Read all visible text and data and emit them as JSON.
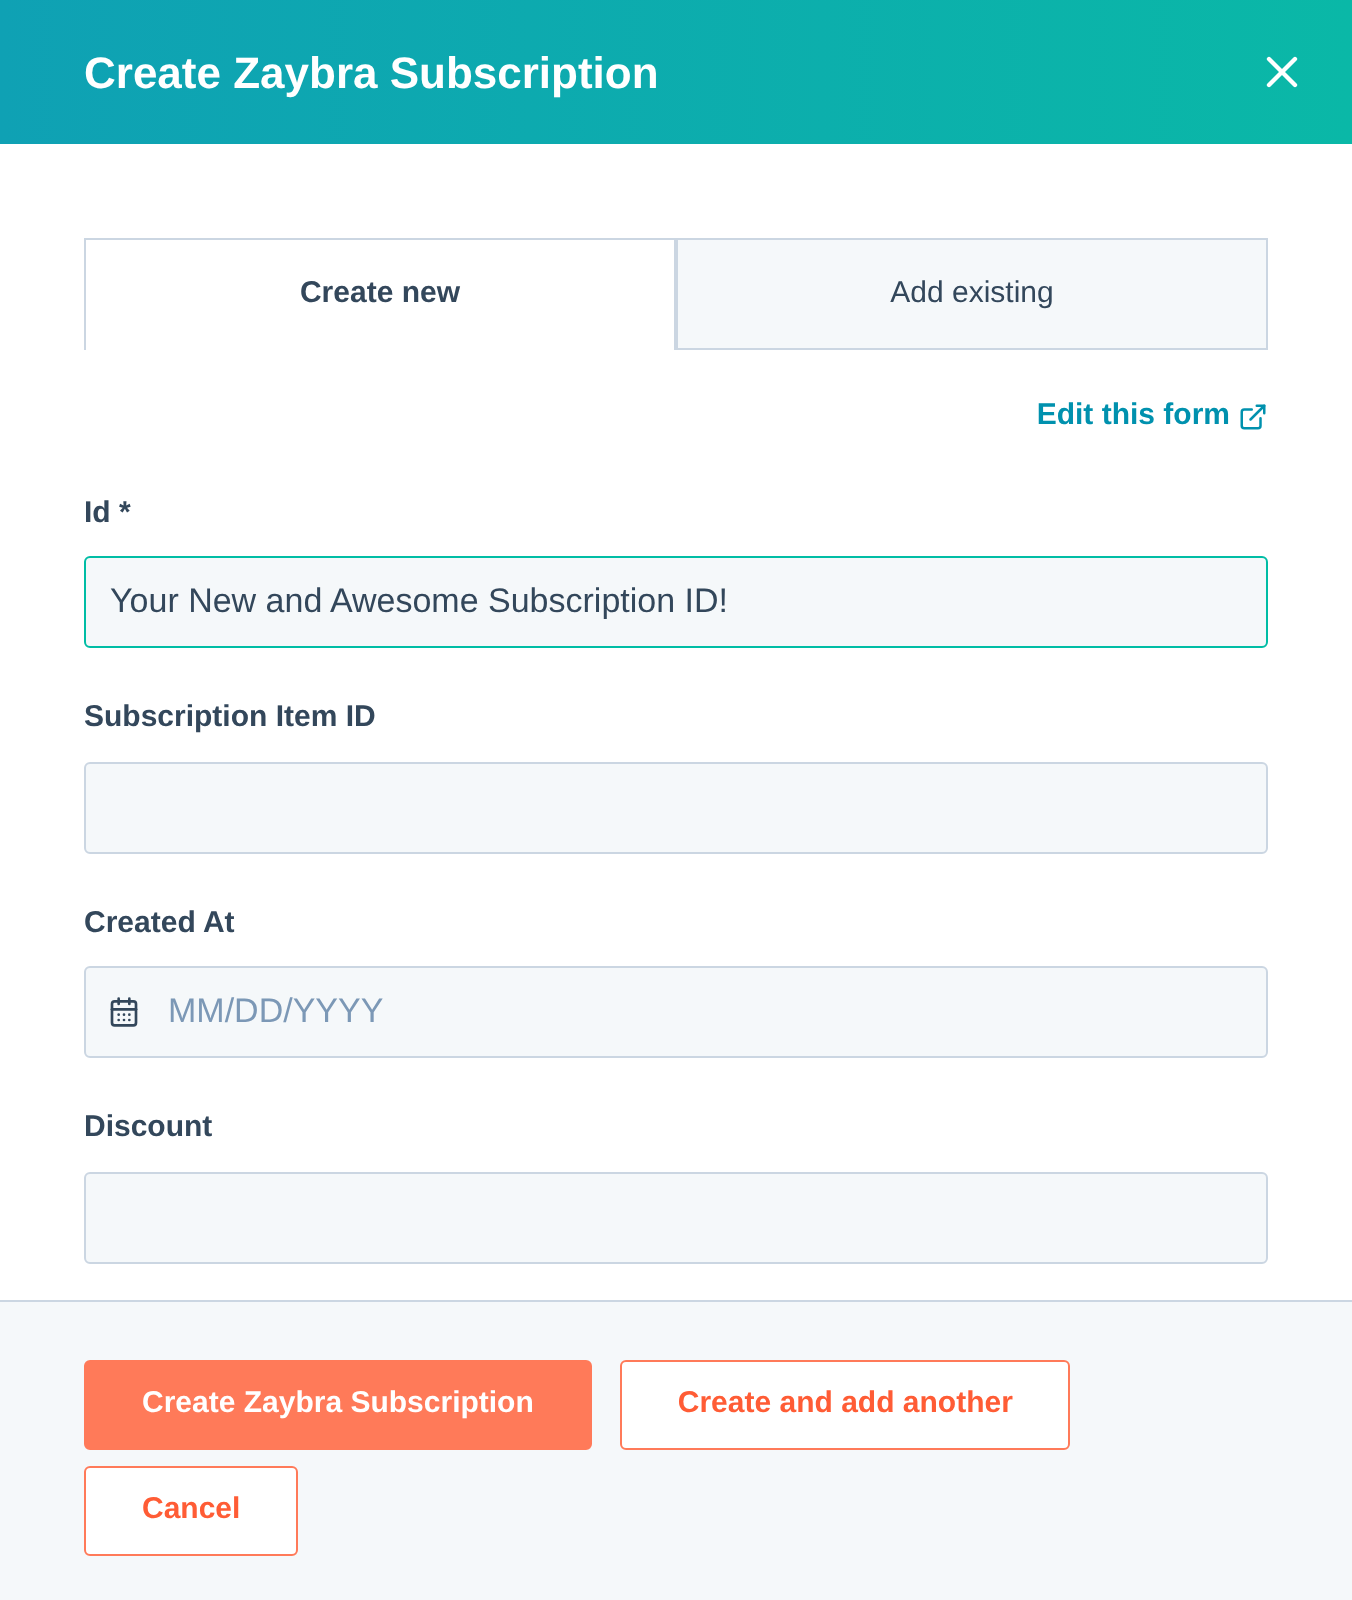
{
  "dialog": {
    "title": "Create Zaybra Subscription"
  },
  "tabs": [
    {
      "label": "Create new",
      "selected": true
    },
    {
      "label": "Add existing",
      "selected": false
    }
  ],
  "edit_link": "Edit this form",
  "fields": [
    {
      "kind": "text",
      "label": "Id *",
      "value": "Your New and Awesome Subscription ID!",
      "focused": true
    },
    {
      "kind": "text",
      "label": "Subscription Item ID",
      "focused": false
    },
    {
      "kind": "date",
      "label": "Created At",
      "placeholder": "MM/DD/YYYY",
      "focused": false
    },
    {
      "kind": "text",
      "label": "Discount",
      "focused": false
    }
  ],
  "buttons": [
    {
      "kind": "primary",
      "label": "Create Zaybra Subscription"
    },
    {
      "kind": "secondary",
      "label": "Create and add another"
    },
    {
      "kind": "secondary",
      "label": "Cancel"
    }
  ]
}
